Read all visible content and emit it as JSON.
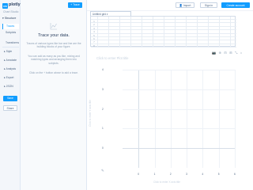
{
  "app": {
    "logo_mark": "cs",
    "logo_text": "plotly",
    "logo_sub": "Chart Studio"
  },
  "sidebar": {
    "section_title": "Structure",
    "items": [
      {
        "label": "Traces",
        "active": true
      },
      {
        "label": "Subplots",
        "active": false
      },
      {
        "label": "Transforms",
        "active": false
      }
    ],
    "sections": [
      {
        "label": "Style"
      },
      {
        "label": "Annotate"
      },
      {
        "label": "Analysis"
      },
      {
        "label": "Export"
      },
      {
        "label": "JSON"
      }
    ],
    "save_label": "Save",
    "share_label": "Share"
  },
  "panel": {
    "title": "Trace your data.",
    "p1": "Traces of various types like bar and line are the building blocks of your figure.",
    "p2": "You can add as many as you like, mixing and matching types and arranging them into subplots.",
    "p3": "Click on the + button above to add a trace.",
    "icon": "line-chart-icon"
  },
  "topbar": {
    "trace_button": "+ Trace",
    "import_label": "Import",
    "signin_label": "Sign in",
    "create_label": "Create account"
  },
  "grid": {
    "tab_label": "Untitled grid",
    "rows": [
      "1",
      "2",
      "3",
      "4",
      "5",
      "6",
      "7",
      "8"
    ]
  },
  "plot": {
    "title": "Click to enter Plot title",
    "x_title": "Click to enter X axis title",
    "y_title": "Click to enter Y axis title",
    "modebar": "📷 ⊕ ⊟ ⊞ ⤡ ⌂",
    "edit_icon": "✎"
  },
  "chart_data": {
    "type": "scatter",
    "series": [],
    "xlabel": "Click to enter X axis title",
    "ylabel": "Click to enter Y axis title",
    "title": "Click to enter Plot title",
    "xlim": [
      -1,
      6
    ],
    "ylim": [
      -1,
      4
    ],
    "x_ticks": [
      "0",
      "1",
      "2",
      "3",
      "4",
      "5",
      "6"
    ],
    "y_ticks": [
      "0",
      "1",
      "2",
      "3",
      "4"
    ],
    "grid": true
  },
  "colors": {
    "accent": "#119dff",
    "text": "#506784",
    "heading": "#2a3f5f"
  }
}
